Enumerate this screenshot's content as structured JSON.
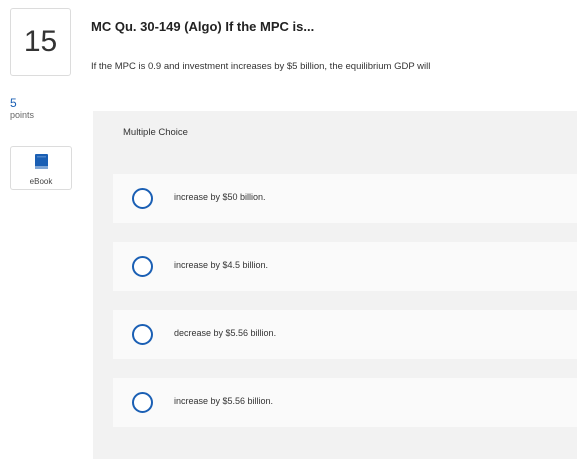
{
  "question": {
    "number": "15",
    "points_value": "5",
    "points_label": "points",
    "title": "MC Qu. 30-149 (Algo) If the MPC is...",
    "text": "If the MPC is 0.9 and investment increases by $5 billion, the equilibrium GDP will"
  },
  "sidebar": {
    "ebook_label": "eBook"
  },
  "multiple_choice": {
    "heading": "Multiple Choice",
    "options": [
      {
        "label": "increase by $50 billion."
      },
      {
        "label": "increase by $4.5 billion."
      },
      {
        "label": "decrease by $5.56 billion."
      },
      {
        "label": "increase by $5.56 billion."
      }
    ]
  },
  "colors": {
    "accent": "#1a5fb4",
    "panel_background": "#f2f2f2",
    "option_background": "#fafafa"
  }
}
